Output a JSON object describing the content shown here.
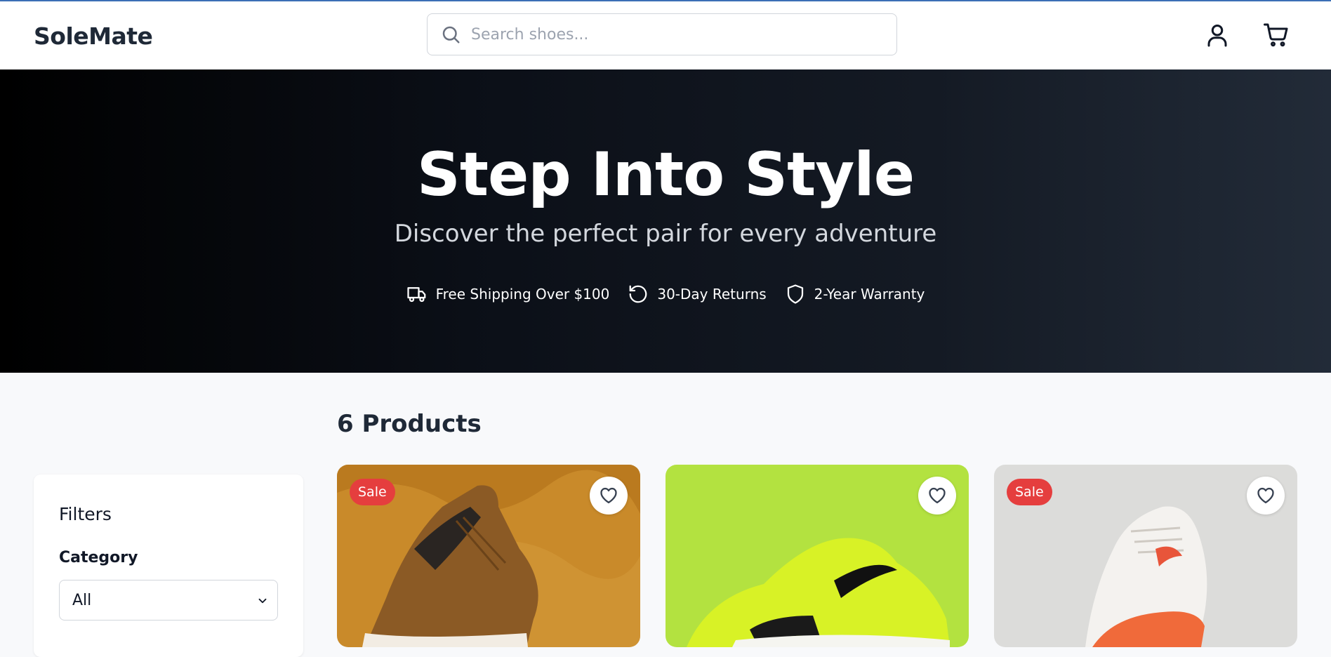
{
  "header": {
    "brand": "SoleMate",
    "search_placeholder": "Search shoes...",
    "icons": [
      "user-icon",
      "cart-icon"
    ]
  },
  "hero": {
    "title": "Step Into Style",
    "subtitle": "Discover the perfect pair for every adventure",
    "features": [
      {
        "icon": "truck-icon",
        "label": "Free Shipping Over $100"
      },
      {
        "icon": "rotate-ccw-icon",
        "label": "30-Day Returns"
      },
      {
        "icon": "shield-icon",
        "label": "2-Year Warranty"
      }
    ],
    "colors": {
      "gradient_start": "#000000",
      "gradient_end": "#222b38"
    }
  },
  "products": {
    "count_label": "6 Products",
    "cards": [
      {
        "badge": "Sale",
        "bg": "#c98a2a"
      },
      {
        "badge": "",
        "bg": "#b3e240"
      },
      {
        "badge": "Sale",
        "bg": "#dcdcda"
      }
    ]
  },
  "filters": {
    "title": "Filters",
    "category_label": "Category",
    "category_value": "All"
  },
  "colors": {
    "accent": "#3b6fb6",
    "sale_badge": "#e53e3e",
    "text_dark": "#1f2937"
  }
}
